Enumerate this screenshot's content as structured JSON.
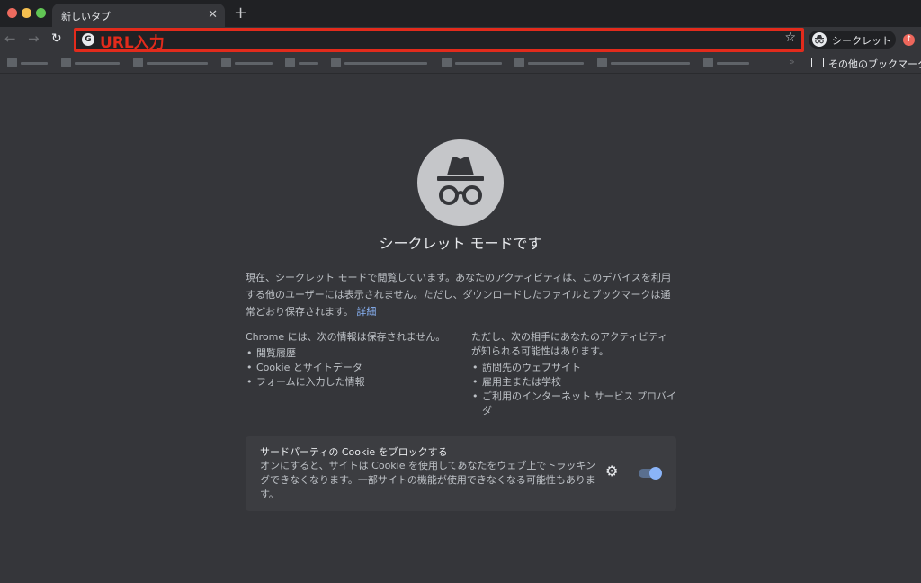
{
  "tab": {
    "title": "新しいタブ",
    "close": "✕",
    "new_tab": "+"
  },
  "toolbar": {
    "back": "←",
    "forward": "→",
    "reload": "↻",
    "omnibox_icon": "G",
    "annotation": "URL入力",
    "bookmark_star": "☆",
    "profile_label": "シークレット",
    "update_badge": "↑"
  },
  "bookmarks": {
    "more": "»",
    "other_label": "その他のブックマーク"
  },
  "page": {
    "title": "シークレット モードです",
    "intro": "現在、シークレット モードで閲覧しています。あなたのアクティビティは、このデバイスを利用する他のユーザーには表示されません。ただし、ダウンロードしたファイルとブックマークは通常どおり保存されます。",
    "details_link": "詳細",
    "left_heading": "Chrome には、次の情報は保存されません。",
    "left_items": [
      "閲覧履歴",
      "Cookie とサイトデータ",
      "フォームに入力した情報"
    ],
    "right_heading": "ただし、次の相手にあなたのアクティビティが知られる可能性はあります。",
    "right_items": [
      "訪問先のウェブサイト",
      "雇用主または学校",
      "ご利用のインターネット サービス プロバイダ"
    ]
  },
  "cookie_card": {
    "title": "サードパーティの Cookie をブロックする",
    "description": "オンにすると、サイトは Cookie を使用してあなたをウェブ上でトラッキングできなくなります。一部サイトの機能が使用できなくなる可能性もあります。",
    "toggle_on": true
  },
  "colors": {
    "annotation_red": "#e22b1c",
    "link_blue": "#8ab4f8",
    "background": "#35363a",
    "titlebar": "#202124"
  }
}
